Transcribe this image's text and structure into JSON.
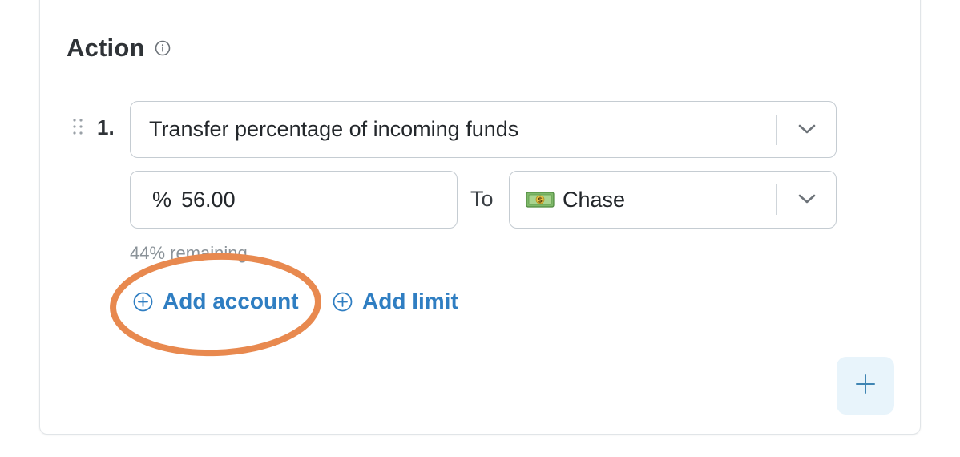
{
  "section": {
    "title": "Action",
    "info_icon": "info-icon"
  },
  "step": {
    "number": "1.",
    "drag_icon": "drag-handle-icon",
    "action_select": {
      "value": "Transfer percentage of incoming funds",
      "icon": "chevron-down-icon"
    },
    "amount": {
      "prefix": "%",
      "value": "56.00"
    },
    "to_label": "To",
    "account_select": {
      "icon": "money-bag-icon",
      "value": "Chase"
    },
    "remaining": "44% remaining"
  },
  "links": {
    "add_account": "Add account",
    "add_limit": "Add limit"
  },
  "add_button": {
    "icon": "plus-icon"
  },
  "colors": {
    "link": "#2f7ec2",
    "annotation": "#e8894f",
    "fab_bg": "#e8f4fb"
  }
}
